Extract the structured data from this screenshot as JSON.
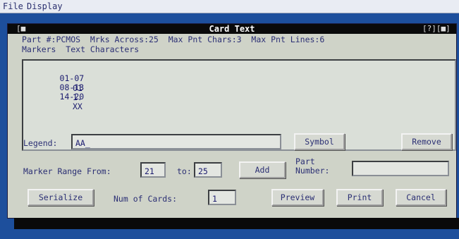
{
  "menubar": {
    "items": [
      {
        "label": "File"
      },
      {
        "label": "Display"
      }
    ]
  },
  "dialog": {
    "title": "Card Text",
    "window_controls": "[?][■]",
    "close_glyph": "[■",
    "info_line_1": "Part #:PCMOS  Mrks Across:25  Max Pnt Chars:3  Max Pnt Lines:6",
    "info_line_2": "Markers  Text Characters",
    "rows": [
      {
        "range": "01-07",
        "text": "01"
      },
      {
        "range": "08-13",
        "text": "1."
      },
      {
        "range": "14-20",
        "text": "XX"
      }
    ],
    "legend_label": "Legend:",
    "legend_value": "AA_",
    "symbol_label": "Symbol",
    "remove_label": "Remove",
    "marker_range_label": "Marker Range From:",
    "from_value": "21",
    "to_label": "to:",
    "to_value": "25",
    "add_label": "Add",
    "part_number_label_1": "Part",
    "part_number_label_2": "Number:",
    "part_number_value": "",
    "serialize_label": "Serialize",
    "num_cards_label": "Num of Cards:",
    "num_cards_value": "1",
    "preview_label": "Preview",
    "print_label": "Print",
    "cancel_label": "Cancel"
  },
  "colors": {
    "desktop": "#1d4f9c",
    "dialog_face": "#cfd3c8",
    "titlebar": "#0a0a0a",
    "text": "#2b2f74"
  }
}
